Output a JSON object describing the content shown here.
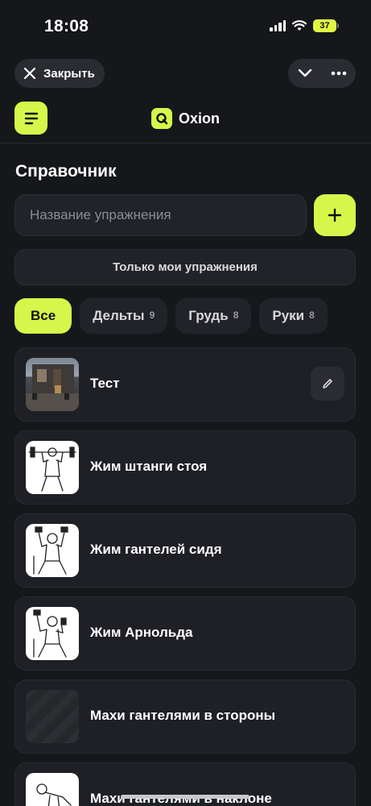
{
  "status": {
    "time": "18:08",
    "battery": "37"
  },
  "topbar": {
    "close_label": "Закрыть"
  },
  "header": {
    "brand": "Oxion"
  },
  "page": {
    "title": "Справочник",
    "search_placeholder": "Название упражнения",
    "only_mine_label": "Только мои упражнения"
  },
  "filters": [
    {
      "label": "Все",
      "count": ""
    },
    {
      "label": "Дельты",
      "count": "9"
    },
    {
      "label": "Грудь",
      "count": "8"
    },
    {
      "label": "Руки",
      "count": "8"
    }
  ],
  "exercises": [
    {
      "name": "Тест",
      "thumb": "photo",
      "editable": true
    },
    {
      "name": "Жим штанги стоя",
      "thumb": "sketch",
      "editable": false
    },
    {
      "name": "Жим гантелей сидя",
      "thumb": "sketch",
      "editable": false
    },
    {
      "name": "Жим Арнольда",
      "thumb": "sketch",
      "editable": false
    },
    {
      "name": "Махи гантелями в стороны",
      "thumb": "placeholder",
      "editable": false
    },
    {
      "name": "Махи гантелями в наклоне",
      "thumb": "sketch",
      "editable": false
    }
  ],
  "colors": {
    "accent": "#d6f74a",
    "background": "#16171b",
    "card": "#1f2025"
  }
}
